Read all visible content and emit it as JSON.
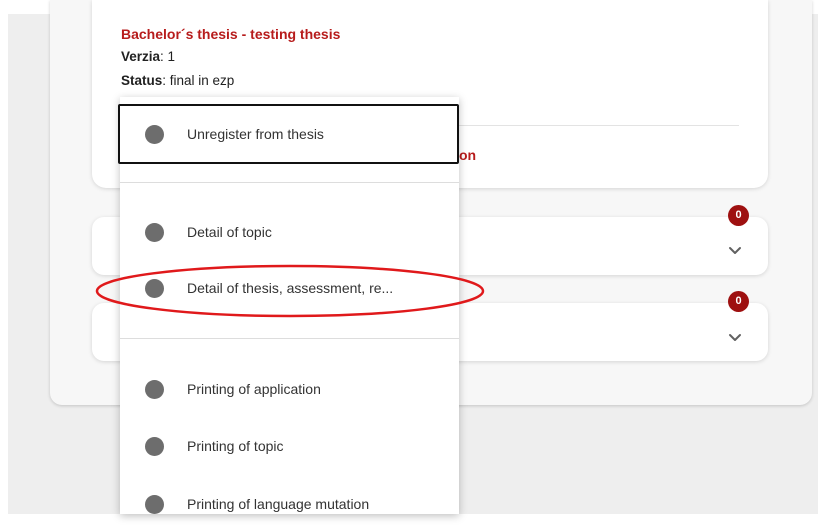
{
  "thesis": {
    "title": "Bachelor´s thesis - testing thesis",
    "version_label": "Verzia",
    "version_value": ": 1",
    "status_label": "Status",
    "status_value": ": final in ezp",
    "partial_link_suffix": "on"
  },
  "cards": [
    {
      "badge_count": "0"
    },
    {
      "badge_count": "0"
    }
  ],
  "menu": {
    "items": [
      {
        "label": "Unregister from thesis"
      },
      {
        "label": "Detail of topic"
      },
      {
        "label": "Detail of thesis, assessment, re..."
      },
      {
        "label": "Printing of application"
      },
      {
        "label": "Printing of topic"
      },
      {
        "label": "Printing of language mutation"
      }
    ]
  },
  "colors": {
    "accent": "#b71c1c",
    "badge": "#9e1010",
    "annotation": "#e0191b",
    "menu_dot": "#6d6d6d"
  },
  "icons": {
    "expand": "chevron-down-icon",
    "menu_item": "circle-icon"
  }
}
